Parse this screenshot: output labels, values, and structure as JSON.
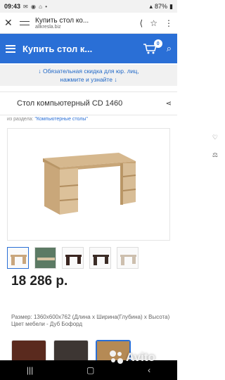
{
  "status_bar": {
    "time": "09:43",
    "battery": "87%"
  },
  "browser": {
    "page_title": "Купить стол ко...",
    "domain": "allkresla.biz"
  },
  "site_header": {
    "title": "Купить стол к...",
    "cart_count": "0",
    "brand_color": "#2a6fd6"
  },
  "notice": {
    "line1": "↓ Обязательная скидка для юр. лиц,",
    "line2": "нажмите и узнайте ↓"
  },
  "product": {
    "title": "Стол компьютерный CD 1460",
    "breadcrumb_prefix": "из раздела:",
    "breadcrumb_link": "\"Компьютерные столы\"",
    "price": "18 286 р.",
    "size_text": "Размер: 1360x600x762 (Длина х Ширина(Глубина) х Высота)",
    "color_text": "Цвет мебели - Дуб Бофорд"
  },
  "thumbnail_colors": [
    "#c9a67d",
    "#5c7a64",
    "#3a2520",
    "#3b2c26",
    "#cdbfae"
  ],
  "swatch_colors": [
    "#5a2a1e",
    "#3d3633",
    "#b58a55"
  ],
  "watermark": {
    "text": "Avito"
  }
}
